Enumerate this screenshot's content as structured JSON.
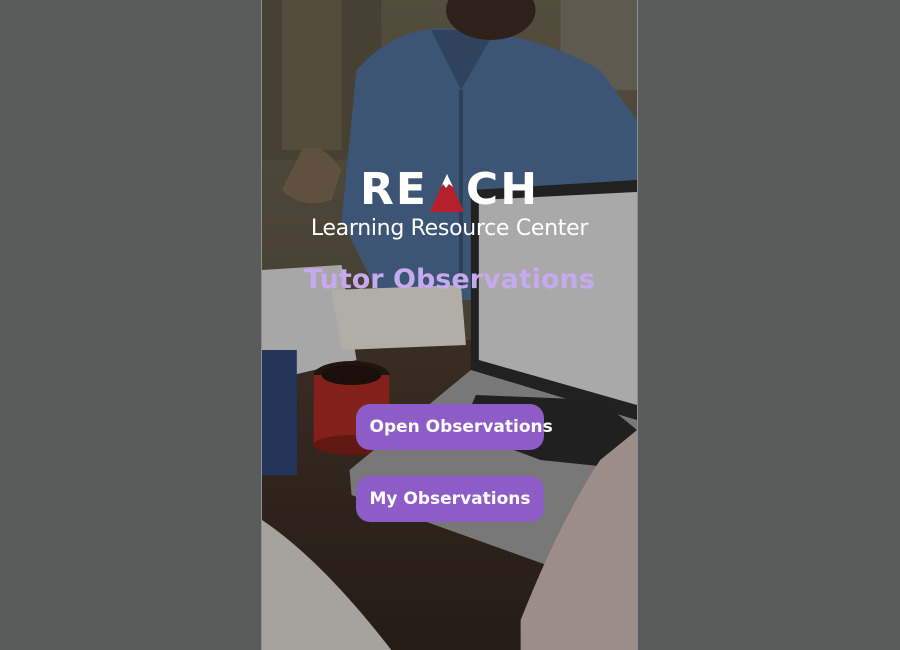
{
  "logo": {
    "letters_left": "RE",
    "letters_right": "CH",
    "subtitle": "Learning Resource Center",
    "mountain_color": "#b4202c"
  },
  "title": "Tutor Observations",
  "buttons": {
    "open_label": "Open Observations",
    "mine_label": "My Observations"
  },
  "colors": {
    "accent": "#8e5cc7",
    "title": "#c7a9ee",
    "frame_background": "#5a5c5c"
  }
}
